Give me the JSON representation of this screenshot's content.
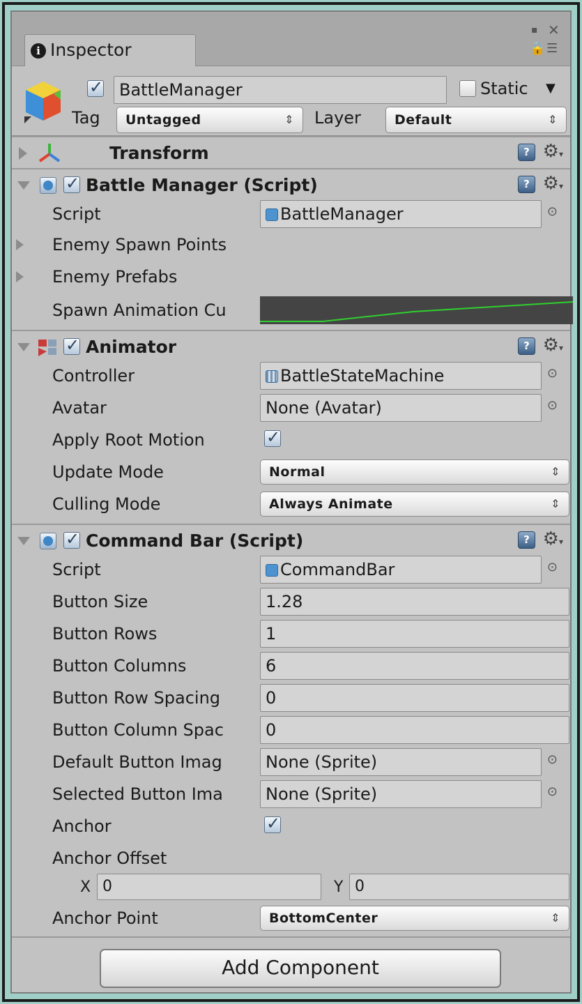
{
  "tab": {
    "title": "Inspector"
  },
  "header": {
    "object_name": "BattleManager",
    "active": true,
    "static_label": "Static",
    "static_checked": false,
    "tag_label": "Tag",
    "tag_value": "Untagged",
    "layer_label": "Layer",
    "layer_value": "Default"
  },
  "transform": {
    "title": "Transform"
  },
  "battle_manager": {
    "title": "Battle Manager (Script)",
    "script_label": "Script",
    "script_value": "BattleManager",
    "spawn_points_label": "Enemy Spawn Points",
    "prefabs_label": "Enemy Prefabs",
    "curve_label": "Spawn Animation Cu",
    "curve_color": "#2fd12f"
  },
  "animator": {
    "title": "Animator",
    "controller_label": "Controller",
    "controller_value": "BattleStateMachine",
    "avatar_label": "Avatar",
    "avatar_value": "None (Avatar)",
    "root_motion_label": "Apply Root Motion",
    "root_motion_checked": true,
    "update_mode_label": "Update Mode",
    "update_mode_value": "Normal",
    "culling_mode_label": "Culling Mode",
    "culling_mode_value": "Always Animate"
  },
  "command_bar": {
    "title": "Command Bar (Script)",
    "script_label": "Script",
    "script_value": "CommandBar",
    "button_size_label": "Button Size",
    "button_size_value": "1.28",
    "button_rows_label": "Button Rows",
    "button_rows_value": "1",
    "button_columns_label": "Button Columns",
    "button_columns_value": "6",
    "row_spacing_label": "Button Row Spacing",
    "row_spacing_value": "0",
    "col_spacing_label": "Button Column Spac",
    "col_spacing_value": "0",
    "default_image_label": "Default Button Imag",
    "default_image_value": "None (Sprite)",
    "selected_image_label": "Selected Button Ima",
    "selected_image_value": "None (Sprite)",
    "anchor_label": "Anchor",
    "anchor_checked": true,
    "anchor_offset_label": "Anchor Offset",
    "offset_x_label": "X",
    "offset_x_value": "0",
    "offset_y_label": "Y",
    "offset_y_value": "0",
    "anchor_point_label": "Anchor Point",
    "anchor_point_value": "BottomCenter"
  },
  "footer": {
    "add_component_label": "Add Component"
  },
  "icons": {
    "info": "info-icon",
    "lock": "lock-icon",
    "menu": "menu-icon",
    "help": "help-icon",
    "gear": "gear-icon",
    "target": "object-picker-icon"
  }
}
